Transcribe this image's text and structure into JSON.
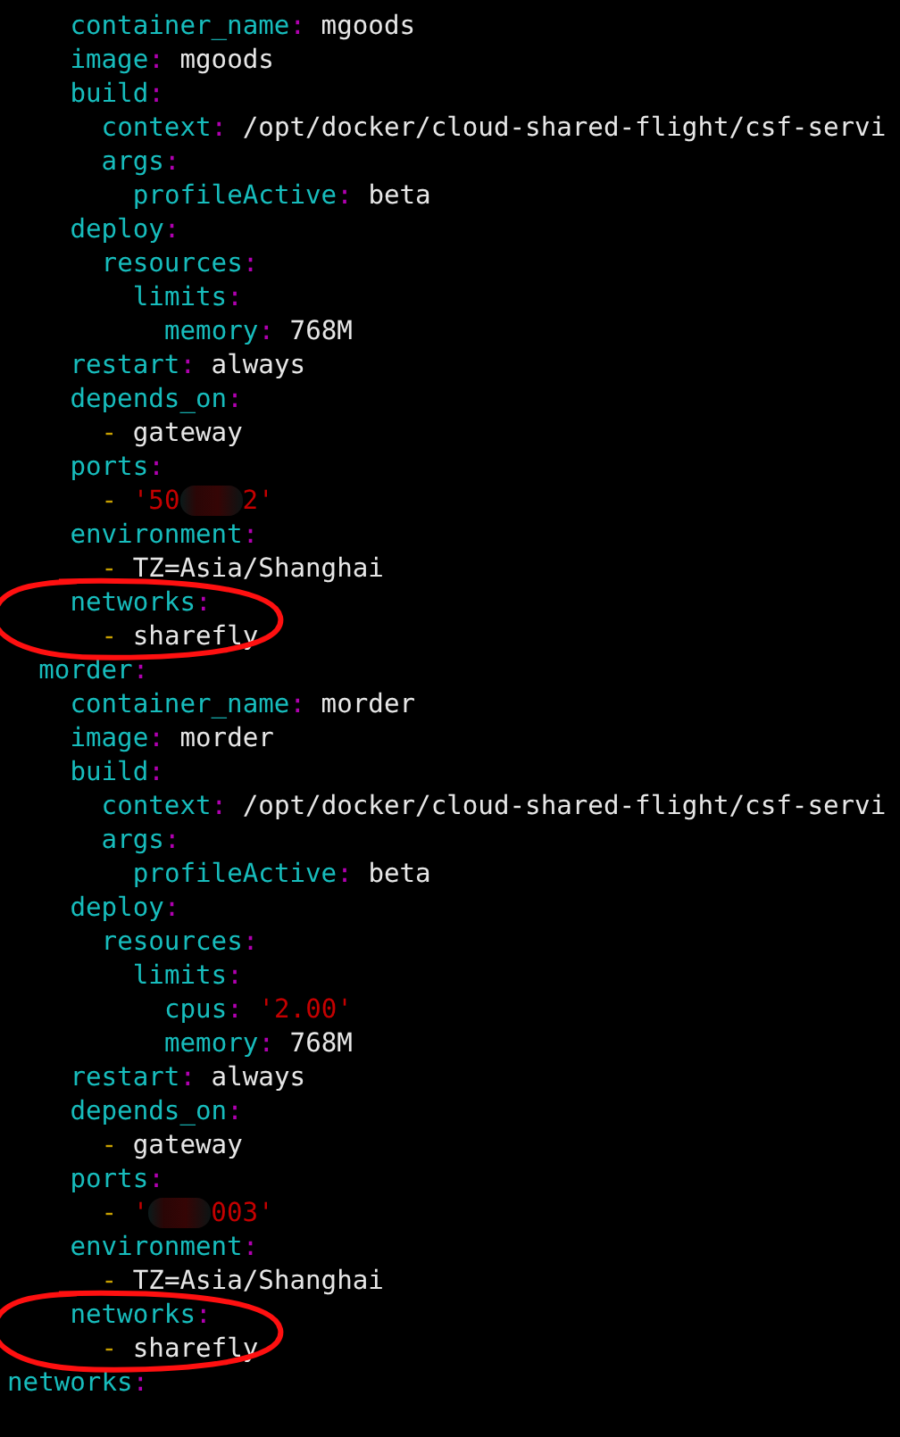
{
  "entries": [
    {
      "kind": "continued",
      "children": [
        {
          "kind": "continued",
          "children": [
            {
              "kind": "pair",
              "key": "container_name:",
              "value": "mgoods"
            },
            {
              "kind": "pair",
              "key": "image:",
              "value": "mgoods"
            },
            {
              "kind": "pair",
              "key": "build:",
              "children": [
                {
                  "kind": "pair",
                  "key": "context:",
                  "value": "/opt/docker/cloud-shared-flight/csf-servi"
                },
                {
                  "kind": "pair",
                  "key": "args:",
                  "children": [
                    {
                      "kind": "pair",
                      "key": "profileActive:",
                      "value": "beta"
                    }
                  ]
                }
              ]
            },
            {
              "kind": "pair",
              "key": "deploy:",
              "children": [
                {
                  "kind": "pair",
                  "key": "resources:",
                  "children": [
                    {
                      "kind": "pair",
                      "key": "limits:",
                      "children": [
                        {
                          "kind": "pair",
                          "key": "memory:",
                          "value": "768M"
                        }
                      ]
                    }
                  ]
                }
              ]
            },
            {
              "kind": "pair",
              "key": "restart:",
              "value": "always"
            },
            {
              "kind": "pair",
              "key": "depends_on:",
              "children": [
                {
                  "kind": "item",
                  "marker": "-",
                  "value": "gateway"
                }
              ]
            },
            {
              "kind": "pair",
              "key": "ports:",
              "children": [
                {
                  "kind": "item",
                  "marker": "-",
                  "value": "'50",
                  "redacted": true,
                  "value_end": "2'",
                  "quoted": true
                }
              ]
            },
            {
              "kind": "pair",
              "key": "environment:",
              "children": [
                {
                  "kind": "item",
                  "marker": "-",
                  "value": "TZ=Asia/Shanghai"
                }
              ]
            },
            {
              "kind": "pair",
              "key": "networks:",
              "annotated": true,
              "children": [
                {
                  "kind": "item",
                  "marker": "-",
                  "value": "sharefly"
                }
              ]
            }
          ]
        },
        {
          "kind": "pair",
          "key": "morder:",
          "children": [
            {
              "kind": "pair",
              "key": "container_name:",
              "value": "morder"
            },
            {
              "kind": "pair",
              "key": "image:",
              "value": "morder"
            },
            {
              "kind": "pair",
              "key": "build:",
              "children": [
                {
                  "kind": "pair",
                  "key": "context:",
                  "value": "/opt/docker/cloud-shared-flight/csf-servi"
                },
                {
                  "kind": "pair",
                  "key": "args:",
                  "children": [
                    {
                      "kind": "pair",
                      "key": "profileActive:",
                      "value": "beta"
                    }
                  ]
                }
              ]
            },
            {
              "kind": "pair",
              "key": "deploy:",
              "children": [
                {
                  "kind": "pair",
                  "key": "resources:",
                  "children": [
                    {
                      "kind": "pair",
                      "key": "limits:",
                      "children": [
                        {
                          "kind": "pair",
                          "key": "cpus:",
                          "value": "'2.00'",
                          "quoted": true
                        },
                        {
                          "kind": "pair",
                          "key": "memory:",
                          "value": "768M"
                        }
                      ]
                    }
                  ]
                }
              ]
            },
            {
              "kind": "pair",
              "key": "restart:",
              "value": "always"
            },
            {
              "kind": "pair",
              "key": "depends_on:",
              "children": [
                {
                  "kind": "item",
                  "marker": "-",
                  "value": "gateway"
                }
              ]
            },
            {
              "kind": "pair",
              "key": "ports:",
              "children": [
                {
                  "kind": "item",
                  "marker": "-",
                  "value": "'",
                  "redacted": true,
                  "value_end": "003'",
                  "quoted": true
                }
              ]
            },
            {
              "kind": "pair",
              "key": "environment:",
              "children": [
                {
                  "kind": "item",
                  "marker": "-",
                  "value": "TZ=Asia/Shanghai"
                }
              ]
            },
            {
              "kind": "pair",
              "key": "networks:",
              "annotated": true,
              "children": [
                {
                  "kind": "item",
                  "marker": "-",
                  "value": "sharefly"
                }
              ]
            }
          ]
        }
      ]
    },
    {
      "kind": "pair",
      "key": "networks:"
    }
  ]
}
